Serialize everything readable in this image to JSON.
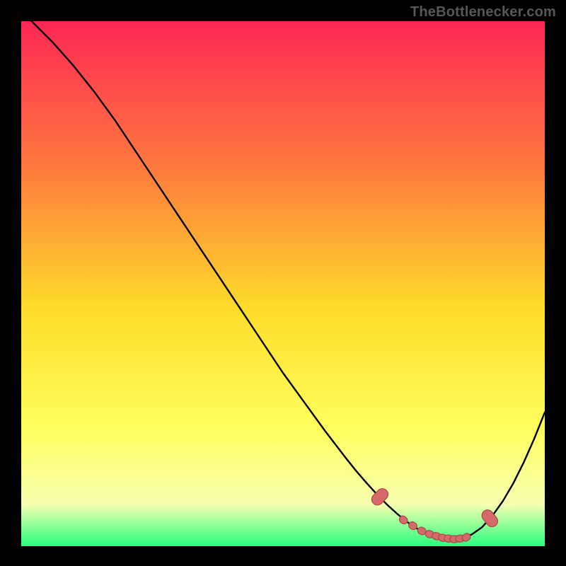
{
  "attribution": "TheBottlenecker.com",
  "colors": {
    "background": "#000000",
    "attribution_text": "#575757",
    "curve": "#000000",
    "marker_fill": "#d66a6a",
    "marker_stroke": "#a84848",
    "gradient_top": "#fd2754",
    "gradient_upper_mid": "#ff7a3e",
    "gradient_mid": "#fedd2a",
    "gradient_lower_mid": "#feff5f",
    "gradient_near_bottom": "#f7ffb0",
    "gradient_bottom": "#29ff7e"
  },
  "chart_data": {
    "type": "line",
    "title": "",
    "xlabel": "",
    "ylabel": "",
    "xlim": [
      0,
      100
    ],
    "ylim": [
      0,
      100
    ],
    "grid": false,
    "legend": false,
    "series": [
      {
        "name": "bottleneck-curve",
        "x": [
          2,
          6,
          10,
          14,
          18,
          22,
          26,
          30,
          34,
          38,
          42,
          46,
          50,
          54,
          58,
          62,
          64,
          66,
          68,
          70,
          72,
          74,
          76,
          78,
          80,
          82,
          84,
          86,
          88,
          90,
          92,
          94,
          96,
          98,
          100
        ],
        "y": [
          100,
          96,
          91.5,
          86.5,
          81,
          75,
          69,
          63,
          57,
          51,
          45,
          39,
          33,
          27.5,
          22,
          16.8,
          14.3,
          12,
          9.8,
          7.8,
          6,
          4.4,
          3.1,
          2.2,
          1.6,
          1.35,
          1.5,
          2.2,
          3.6,
          5.8,
          8.6,
          12,
          16,
          20.5,
          25.5
        ]
      }
    ],
    "markers": {
      "name": "recommended-range",
      "points": [
        {
          "x": 68.5,
          "y": 9.4
        },
        {
          "x": 73.0,
          "y": 5.0
        },
        {
          "x": 74.8,
          "y": 3.9
        },
        {
          "x": 76.5,
          "y": 2.9
        },
        {
          "x": 78.0,
          "y": 2.3
        },
        {
          "x": 79.3,
          "y": 1.9
        },
        {
          "x": 80.5,
          "y": 1.6
        },
        {
          "x": 81.6,
          "y": 1.45
        },
        {
          "x": 82.7,
          "y": 1.35
        },
        {
          "x": 83.8,
          "y": 1.45
        },
        {
          "x": 85.0,
          "y": 1.7
        },
        {
          "x": 89.5,
          "y": 5.3
        }
      ]
    }
  }
}
